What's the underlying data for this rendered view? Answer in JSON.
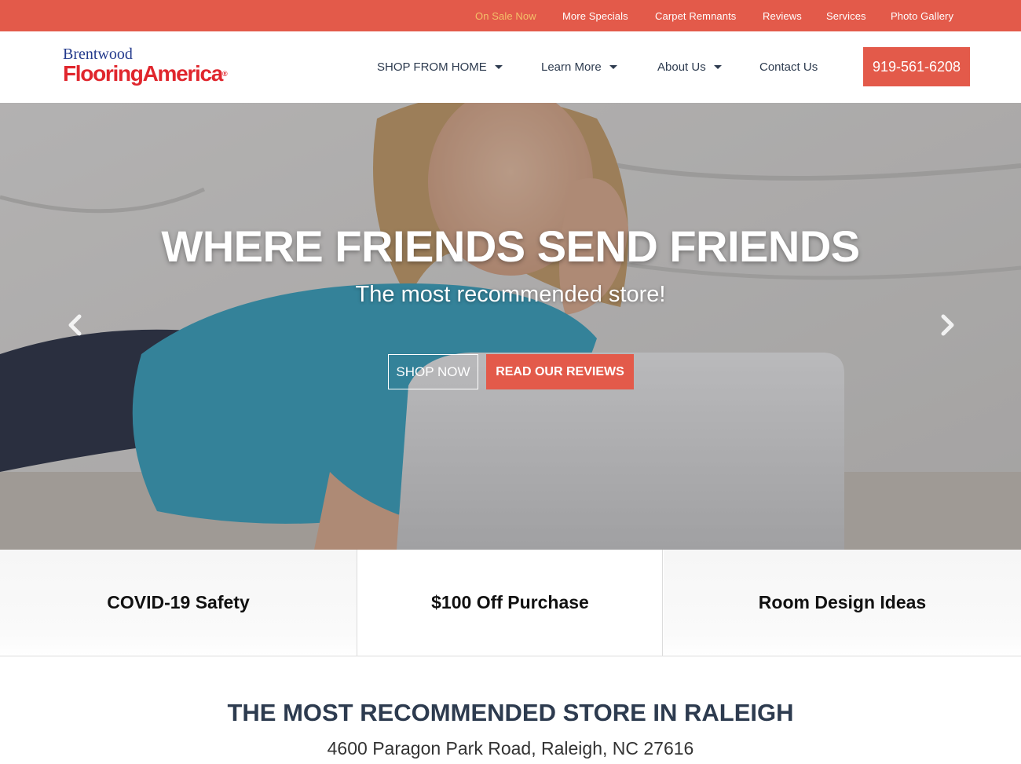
{
  "topbar": {
    "links": [
      {
        "label": "On Sale Now",
        "active": true
      },
      {
        "label": "More Specials"
      },
      {
        "label": "Carpet Remnants"
      },
      {
        "label": "Reviews"
      },
      {
        "label": "Services"
      },
      {
        "label": "Photo Gallery"
      }
    ]
  },
  "logo": {
    "line1": "Brentwood",
    "line2": "FlooringAmerica",
    "mark": "®"
  },
  "nav": {
    "items": [
      {
        "label": "SHOP FROM HOME",
        "has_dropdown": true
      },
      {
        "label": "Learn More",
        "has_dropdown": true
      },
      {
        "label": "About Us",
        "has_dropdown": true
      },
      {
        "label": "Contact Us",
        "has_dropdown": false
      }
    ],
    "phone": "919-561-6208"
  },
  "hero": {
    "title": "WHERE FRIENDS SEND FRIENDS",
    "subtitle": "The most recommended store!",
    "btn_shop": "SHOP NOW",
    "btn_reviews": "READ OUR REVIEWS",
    "prev_icon": "chevron-left-icon",
    "next_icon": "chevron-right-icon"
  },
  "features": [
    {
      "label": "COVID-19 Safety"
    },
    {
      "label": "$100 Off Purchase"
    },
    {
      "label": "Room Design Ideas"
    }
  ],
  "intro": {
    "title": "THE MOST RECOMMENDED STORE IN RALEIGH",
    "address": "4600 Paragon Park Road,  Raleigh, NC 27616"
  },
  "colors": {
    "accent": "#e35a4a",
    "active_link": "#f4c06a",
    "nav_text": "#2d3b4f",
    "logo_blue": "#233a8c",
    "logo_red": "#e0262d"
  }
}
